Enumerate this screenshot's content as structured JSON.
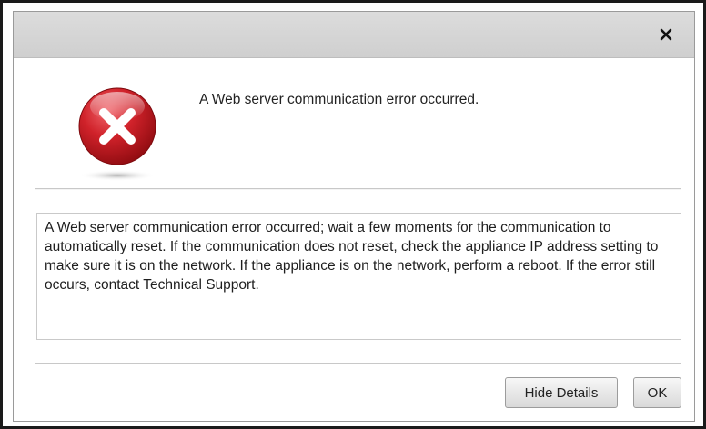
{
  "dialog": {
    "summary": "A Web server communication error occurred.",
    "details": "A Web server communication error occurred; wait a few moments for the communication to automatically reset. If the communication does not reset, check the appliance IP address setting to make sure it is on the network. If the appliance is on the network, perform a reboot. If the error still occurs, contact Technical Support.",
    "close_glyph": "×",
    "icon": "error-x-circle-icon"
  },
  "buttons": {
    "hide_details": "Hide Details",
    "ok": "OK"
  },
  "colors": {
    "error_red": "#c4161c",
    "titlebar": "#d4d4d4"
  }
}
